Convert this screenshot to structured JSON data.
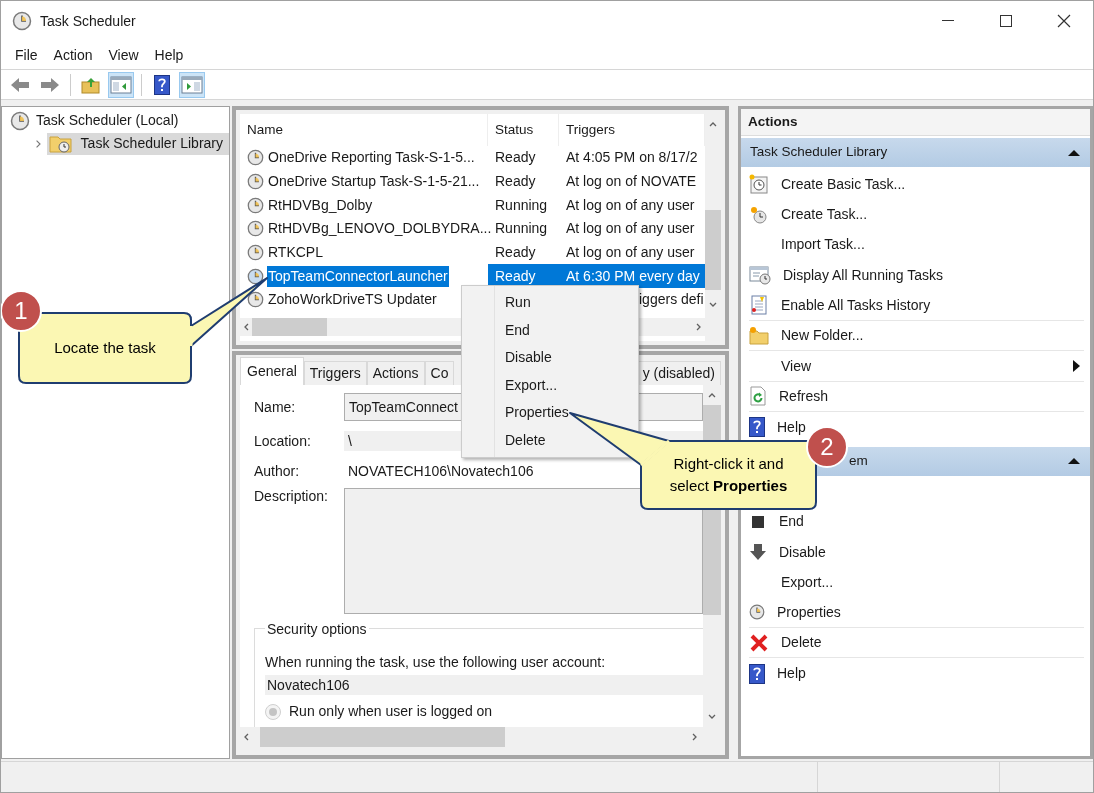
{
  "window": {
    "title": "Task Scheduler"
  },
  "menu": [
    "File",
    "Action",
    "View",
    "Help"
  ],
  "toolbar": [
    {
      "kind": "back",
      "pressed": false
    },
    {
      "kind": "forward",
      "pressed": false
    },
    {
      "kind": "up",
      "pressed": false
    },
    {
      "kind": "tree-pane",
      "pressed": true
    },
    {
      "kind": "help",
      "pressed": false
    },
    {
      "kind": "action-pane",
      "pressed": true
    }
  ],
  "tree": [
    {
      "label": "Task Scheduler (Local)",
      "selected": false,
      "children": [
        {
          "label": "Task Scheduler Library",
          "selected": true,
          "expanded": false
        }
      ]
    }
  ],
  "task_list": {
    "columns": [
      "Name",
      "Status",
      "Triggers"
    ],
    "rows": [
      {
        "name": "OneDrive Reporting Task-S-1-5...",
        "status": "Ready",
        "triggers": "At 4:05 PM on 8/17/2",
        "selected": false
      },
      {
        "name": "OneDrive Startup Task-S-1-5-21...",
        "status": "Ready",
        "triggers": "At log on of NOVATE",
        "selected": false
      },
      {
        "name": "RtHDVBg_Dolby",
        "status": "Running",
        "triggers": "At log on of any user",
        "selected": false
      },
      {
        "name": "RtHDVBg_LENOVO_DOLBYDRA...",
        "status": "Running",
        "triggers": "At log on of any user",
        "selected": false
      },
      {
        "name": "RTKCPL",
        "status": "Ready",
        "triggers": "At log on of any user",
        "selected": false
      },
      {
        "name": "TopTeamConnectorLauncher",
        "status": "Ready",
        "triggers": "At 6:30 PM every day",
        "selected": true
      },
      {
        "name": "ZohoWorkDriveTS Updater",
        "triggers": "iggers defi",
        "selected": false
      }
    ]
  },
  "context_menu": {
    "items": [
      "Run",
      "End",
      "Disable",
      "Export...",
      "Properties",
      "Delete"
    ]
  },
  "details": {
    "tabs": [
      {
        "label": "General",
        "selected": true
      },
      {
        "label": "Triggers",
        "selected": false
      },
      {
        "label": "Actions",
        "selected": false
      },
      {
        "label": "Co",
        "selected": false
      },
      {
        "label": "y (disabled)",
        "selected": false
      }
    ],
    "fields": [
      {
        "kind": "input",
        "label": "Name:",
        "value": "TopTeamConnect"
      },
      {
        "kind": "readonly",
        "label": "Location:",
        "value": "\\"
      },
      {
        "kind": "text",
        "label": "Author:",
        "value": "NOVATECH106\\Novatech106"
      },
      {
        "kind": "textarea",
        "label": "Description:"
      }
    ],
    "security": {
      "title": "Security options",
      "prompt": "When running the task, use the following user account:",
      "account": "Novatech106",
      "options": [
        {
          "label": "Run only when user is logged on",
          "selected": true
        }
      ]
    }
  },
  "actions": {
    "title": "Actions",
    "groups": [
      {
        "title": "Task Scheduler Library",
        "expanded": true,
        "items": [
          {
            "kind": "basic-task",
            "label": "Create Basic Task...",
            "divider": false
          },
          {
            "kind": "new-task",
            "label": "Create Task...",
            "divider": false
          },
          {
            "kind": "plain",
            "label": "Import Task...",
            "divider": false
          },
          {
            "kind": "running",
            "label": "Display All Running Tasks",
            "divider": false
          },
          {
            "kind": "history",
            "label": "Enable All Tasks History",
            "divider": true
          },
          {
            "kind": "folder",
            "label": "New Folder...",
            "divider": true
          },
          {
            "kind": "submenu",
            "label": "View",
            "divider": true
          },
          {
            "kind": "refresh",
            "label": "Refresh",
            "divider": true
          },
          {
            "kind": "help",
            "label": "Help",
            "divider": false
          }
        ]
      },
      {
        "title": "em",
        "expanded": true,
        "items": [
          {
            "kind": "end",
            "label": "End",
            "divider": false
          },
          {
            "kind": "disable",
            "label": "Disable",
            "divider": false
          },
          {
            "kind": "plain",
            "label": "Export...",
            "divider": false
          },
          {
            "kind": "properties",
            "label": "Properties",
            "divider": true
          },
          {
            "kind": "delete",
            "label": "Delete",
            "divider": true
          },
          {
            "kind": "help",
            "label": "Help",
            "divider": false
          }
        ]
      }
    ]
  },
  "callouts": [
    {
      "number": "1",
      "text": "Locate the task"
    },
    {
      "number": "2",
      "text": "Right-click it and\nselect **Properties**"
    }
  ]
}
